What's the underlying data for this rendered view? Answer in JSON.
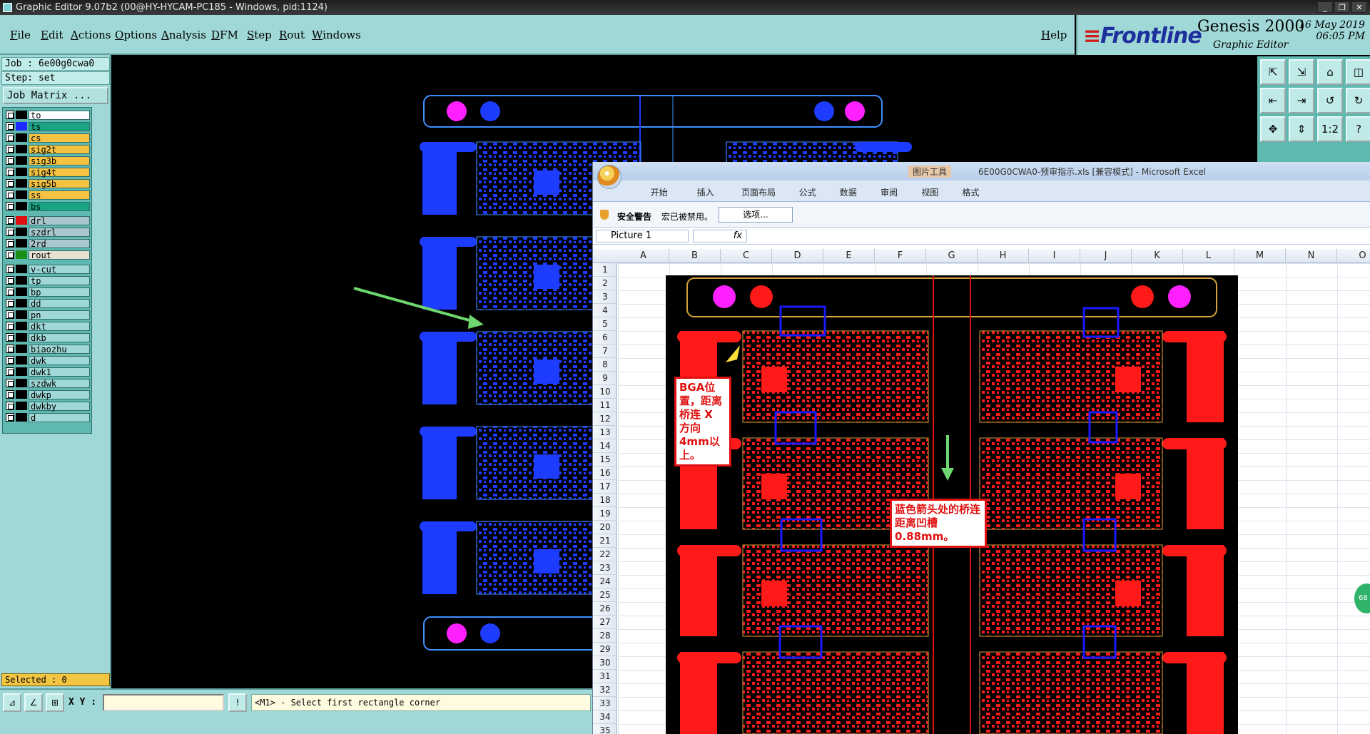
{
  "window": {
    "title": "Graphic Editor 9.07b2 (00@HY-HYCAM-PC185 - Windows, pid:1124)"
  },
  "menu": {
    "items": [
      "File",
      "Edit",
      "Actions",
      "Options",
      "Analysis",
      "DFM",
      "Step",
      "Rout",
      "Windows"
    ],
    "help": "Help"
  },
  "brand": {
    "logo": "Frontline",
    "product": "Genesis 2000",
    "subtitle": "Graphic Editor",
    "date": "16 May 2019",
    "time": "06:05 PM"
  },
  "left_panel": {
    "job": "Job : 6e00g0cwa0",
    "step": "Step: set",
    "job_matrix": "Job Matrix ...",
    "selected": "Selected : 0"
  },
  "layers": [
    {
      "name": "to",
      "color": "#ffffff",
      "swatch": "#000000"
    },
    {
      "name": "ts",
      "color": "#1aa585",
      "swatch": "#1a2cff"
    },
    {
      "name": "cs",
      "color": "#f5c242",
      "swatch": "#000000"
    },
    {
      "name": "sig2t",
      "color": "#f5c242",
      "swatch": "#000000"
    },
    {
      "name": "sig3b",
      "color": "#f5c242",
      "swatch": "#000000"
    },
    {
      "name": "sig4t",
      "color": "#f5c242",
      "swatch": "#000000"
    },
    {
      "name": "sig5b",
      "color": "#f5c242",
      "swatch": "#000000"
    },
    {
      "name": "ss",
      "color": "#f5c242",
      "swatch": "#000000"
    },
    {
      "name": "bs",
      "color": "#1aa585",
      "swatch": "#000000"
    },
    {
      "name": "drl",
      "color": "#a9c7cc",
      "swatch": "#e01010"
    },
    {
      "name": "szdrl",
      "color": "#a9c7cc",
      "swatch": "#000000"
    },
    {
      "name": "2rd",
      "color": "#a9c7cc",
      "swatch": "#000000"
    },
    {
      "name": "rout",
      "color": "#e8e0d0",
      "swatch": "#1a8f1a"
    },
    {
      "name": "v-cut",
      "color": "#9fd8d6",
      "swatch": "#000000"
    },
    {
      "name": "tp",
      "color": "#9fd8d6",
      "swatch": "#000000"
    },
    {
      "name": "bp",
      "color": "#9fd8d6",
      "swatch": "#000000"
    },
    {
      "name": "dd",
      "color": "#9fd8d6",
      "swatch": "#000000"
    },
    {
      "name": "pn",
      "color": "#9fd8d6",
      "swatch": "#000000"
    },
    {
      "name": "dkt",
      "color": "#9fd8d6",
      "swatch": "#000000"
    },
    {
      "name": "dkb",
      "color": "#9fd8d6",
      "swatch": "#000000"
    },
    {
      "name": "biaozhu",
      "color": "#9fd8d6",
      "swatch": "#000000"
    },
    {
      "name": "dwk",
      "color": "#9fd8d6",
      "swatch": "#000000"
    },
    {
      "name": "dwk1",
      "color": "#9fd8d6",
      "swatch": "#000000"
    },
    {
      "name": "szdwk",
      "color": "#9fd8d6",
      "swatch": "#000000"
    },
    {
      "name": "dwkp",
      "color": "#9fd8d6",
      "swatch": "#000000"
    },
    {
      "name": "dwkby",
      "color": "#9fd8d6",
      "swatch": "#000000"
    },
    {
      "name": "d",
      "color": "#9fd8d6",
      "swatch": "#000000"
    }
  ],
  "toolbar_right": [
    "⇱",
    "⇲",
    "⌂",
    "◫",
    "⇤",
    "⇥",
    "↺",
    "↻",
    "✥",
    "⇕",
    "1:2",
    "?"
  ],
  "status": {
    "xy_label": "X Y :",
    "xy_value": "",
    "message": "<M1> - Select first rectangle corner"
  },
  "excel": {
    "context_tab": "图片工具",
    "document": "6E00G0CWA0-预审指示.xls  [兼容模式]  - Microsoft Excel",
    "tabs": [
      "开始",
      "插入",
      "页面布局",
      "公式",
      "数据",
      "审阅",
      "视图",
      "格式"
    ],
    "security_label": "安全警告",
    "security_text": "宏已被禁用。",
    "options_button": "选项...",
    "name_box": "Picture 1",
    "fx": "fx",
    "columns": [
      "A",
      "B",
      "C",
      "D",
      "E",
      "F",
      "G",
      "H",
      "I",
      "J",
      "K",
      "L",
      "M",
      "N",
      "O"
    ],
    "rows": [
      "1",
      "2",
      "3",
      "4",
      "5",
      "6",
      "7",
      "8",
      "9",
      "10",
      "11",
      "12",
      "13",
      "14",
      "15",
      "16",
      "17",
      "18",
      "19",
      "20",
      "21",
      "22",
      "23",
      "24",
      "25",
      "26",
      "27",
      "28",
      "29",
      "30",
      "31",
      "32",
      "33",
      "34",
      "35"
    ],
    "callout_bga": "BGA位置，距离桥连 X 方向4mm以上。",
    "callout_bridge": "蓝色箭头处的桥连距离凹槽0.88mm。"
  },
  "badge": "68"
}
